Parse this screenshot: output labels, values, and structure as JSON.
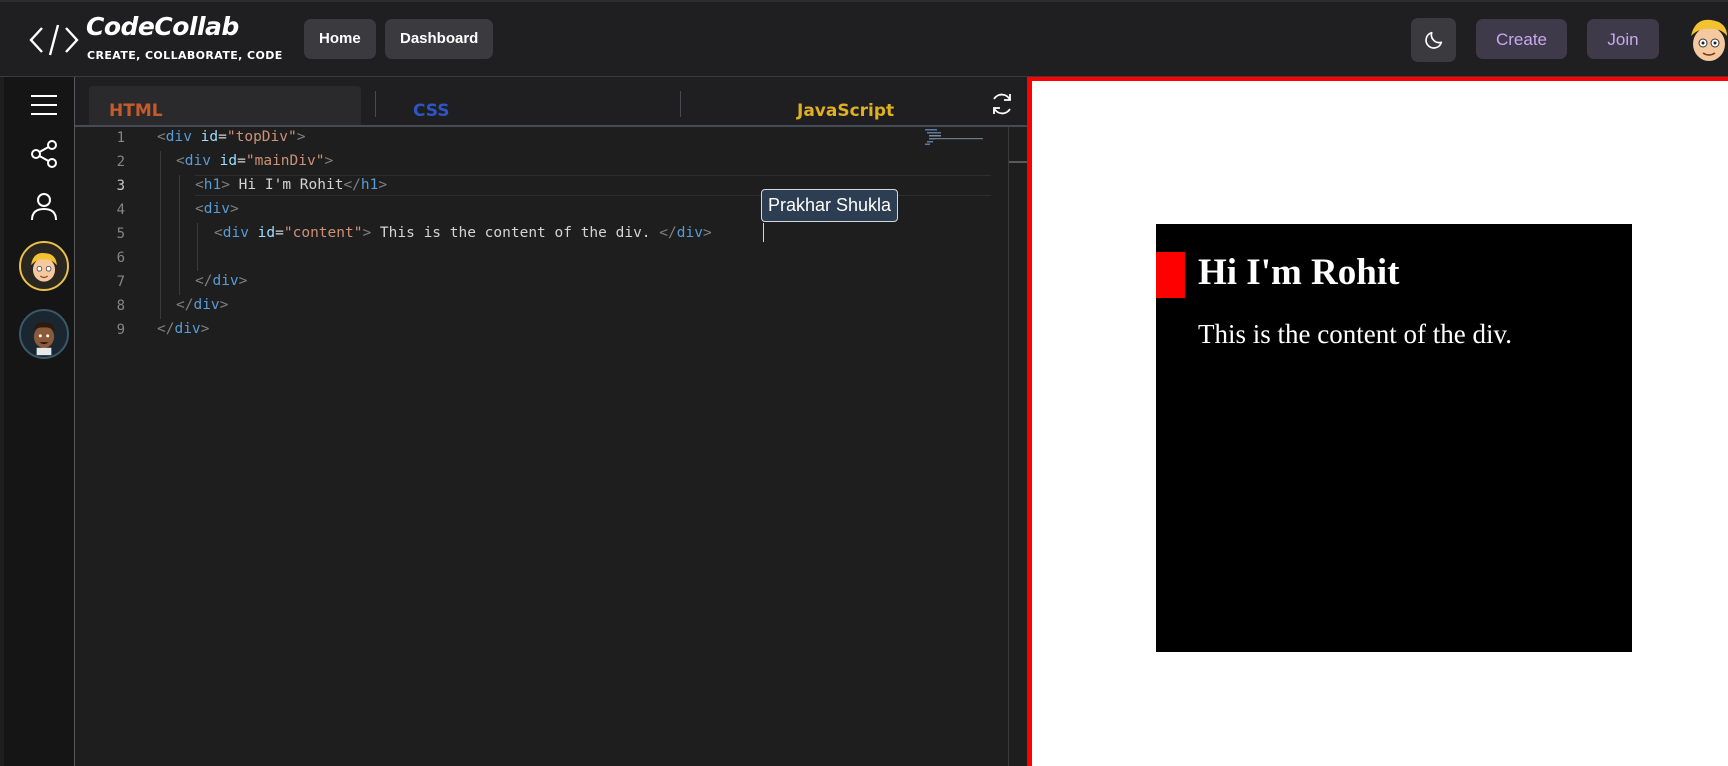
{
  "header": {
    "logo_title": "CodeCollab",
    "logo_tagline": "CREATE, COLLABORATE, CODE",
    "nav": {
      "home": "Home",
      "dashboard": "Dashboard"
    },
    "actions": {
      "create": "Create",
      "join": "Join"
    },
    "accent_color": "#c8a8ef"
  },
  "sidebar": {
    "icons": [
      "menu-icon",
      "share-icon",
      "user-icon"
    ],
    "collaborators": [
      "avatar-yellow-hair",
      "avatar-dark-hair"
    ]
  },
  "editor": {
    "tabs": {
      "html": "HTML",
      "css": "CSS",
      "js": "JavaScript"
    },
    "tab_colors": {
      "html": "#c55a2a",
      "css": "#2e55c8",
      "js": "#e0b020"
    },
    "line_numbers": [
      "1",
      "2",
      "3",
      "4",
      "5",
      "6",
      "7",
      "8",
      "9"
    ],
    "active_line": 3,
    "code": {
      "l1_attr_val": "\"topDiv\"",
      "l2_attr_val": "\"mainDiv\"",
      "l3_text": " Hi I'm Rohit",
      "l5_attr_val": "\"content\"",
      "l5_text": " This is the content of the div. "
    },
    "cursor_tooltip": "Prakhar Shukla"
  },
  "preview": {
    "heading": "Hi I'm Rohit",
    "content": "This is the content of the div.",
    "colors": {
      "frame": "#ff0000",
      "box": "#000000"
    }
  }
}
